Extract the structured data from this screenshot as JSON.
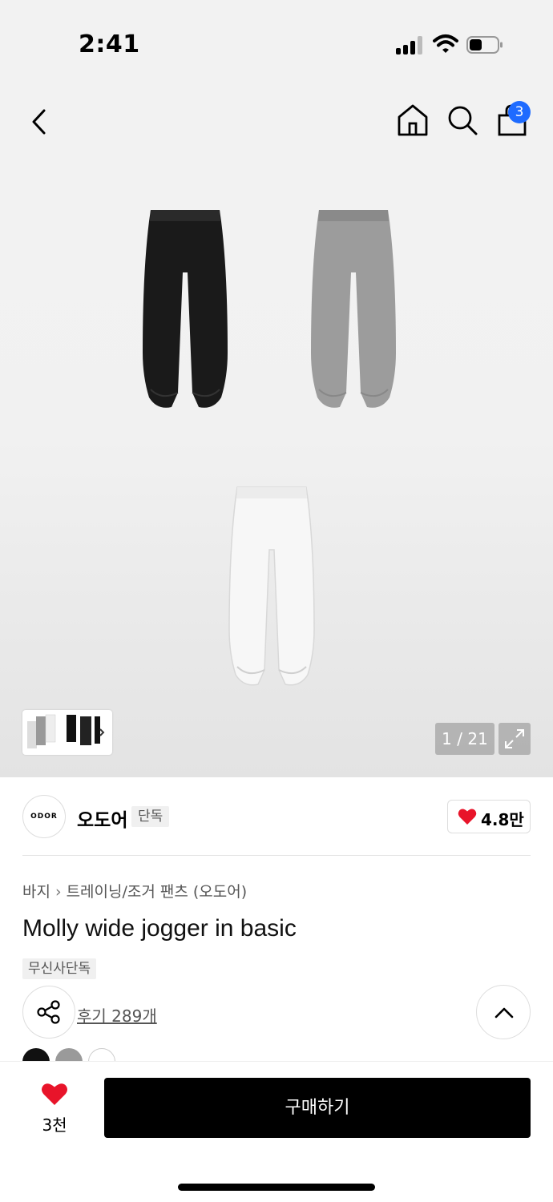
{
  "status_bar": {
    "time": "2:41"
  },
  "header": {
    "cart_count": "3"
  },
  "gallery": {
    "page_indicator": "1 / 21"
  },
  "brand": {
    "logo_text": "ODOR",
    "name": "오도어",
    "tag": "단독",
    "likes": "4.8만"
  },
  "breadcrumb": [
    "바지",
    "트레이닝/조거 팬츠 (오도어)"
  ],
  "product": {
    "title": "Molly wide jogger in basic",
    "exclusive_tag": "무신사단독",
    "reviews": "후기 289개"
  },
  "colors": [
    "#111111",
    "#9a9a9a",
    "#ffffff"
  ],
  "bottom": {
    "fav_count": "3천",
    "buy_label": "구매하기"
  },
  "accent": {
    "badge": "#1e6bff",
    "heart": "#e8142a"
  }
}
